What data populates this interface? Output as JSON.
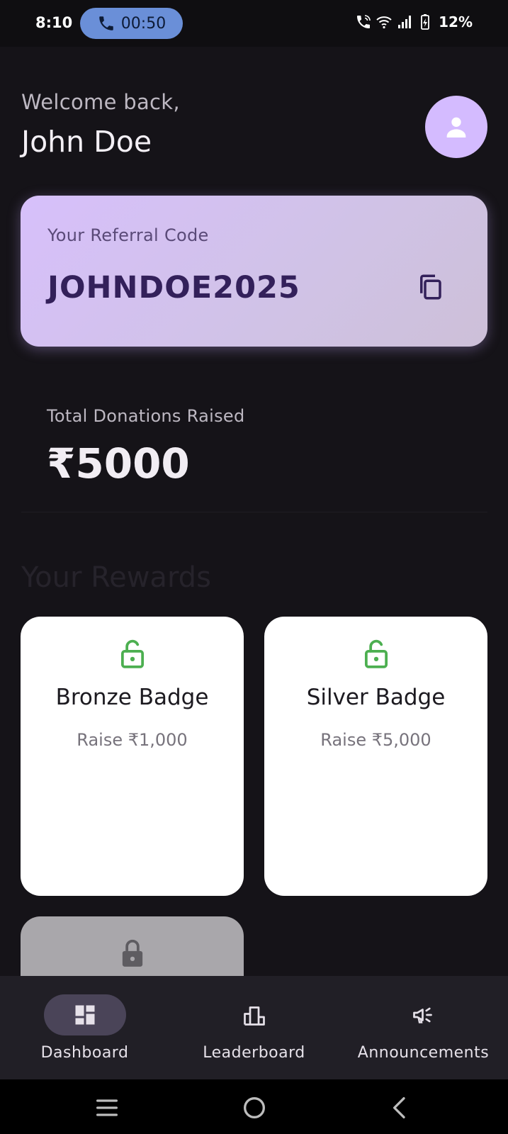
{
  "status_bar": {
    "time": "8:10",
    "call_duration": "00:50",
    "battery": "12%",
    "icons": [
      "phone-icon",
      "call-status-icon",
      "wifi-icon",
      "signal-icon",
      "battery-charging-icon"
    ]
  },
  "header": {
    "welcome": "Welcome back,",
    "name": "John Doe",
    "avatar_icon": "person-icon"
  },
  "referral": {
    "label": "Your Referral Code",
    "code": "JOHNDOE2025",
    "copy_icon": "copy-icon"
  },
  "donations": {
    "label": "Total Donations Raised",
    "value": "₹5000"
  },
  "rewards": {
    "title": "Your Rewards",
    "items": [
      {
        "name": "Bronze Badge",
        "goal": "Raise ₹1,000",
        "icon": "lock-open-icon",
        "unlocked": true
      },
      {
        "name": "Silver Badge",
        "goal": "Raise ₹5,000",
        "icon": "lock-open-icon",
        "unlocked": true
      },
      {
        "name": "",
        "goal": "",
        "icon": "lock-icon",
        "unlocked": false
      }
    ]
  },
  "nav": {
    "items": [
      {
        "label": "Dashboard",
        "icon": "dashboard-icon",
        "active": true
      },
      {
        "label": "Leaderboard",
        "icon": "leaderboard-icon",
        "active": false
      },
      {
        "label": "Announcements",
        "icon": "campaign-icon",
        "active": false
      }
    ]
  },
  "system_nav": [
    "recents-icon",
    "home-icon",
    "back-icon"
  ],
  "colors": {
    "background": "#151318",
    "accent": "#d4bbff",
    "unlocked": "#4caf50",
    "nav_active": "#4a4458"
  }
}
